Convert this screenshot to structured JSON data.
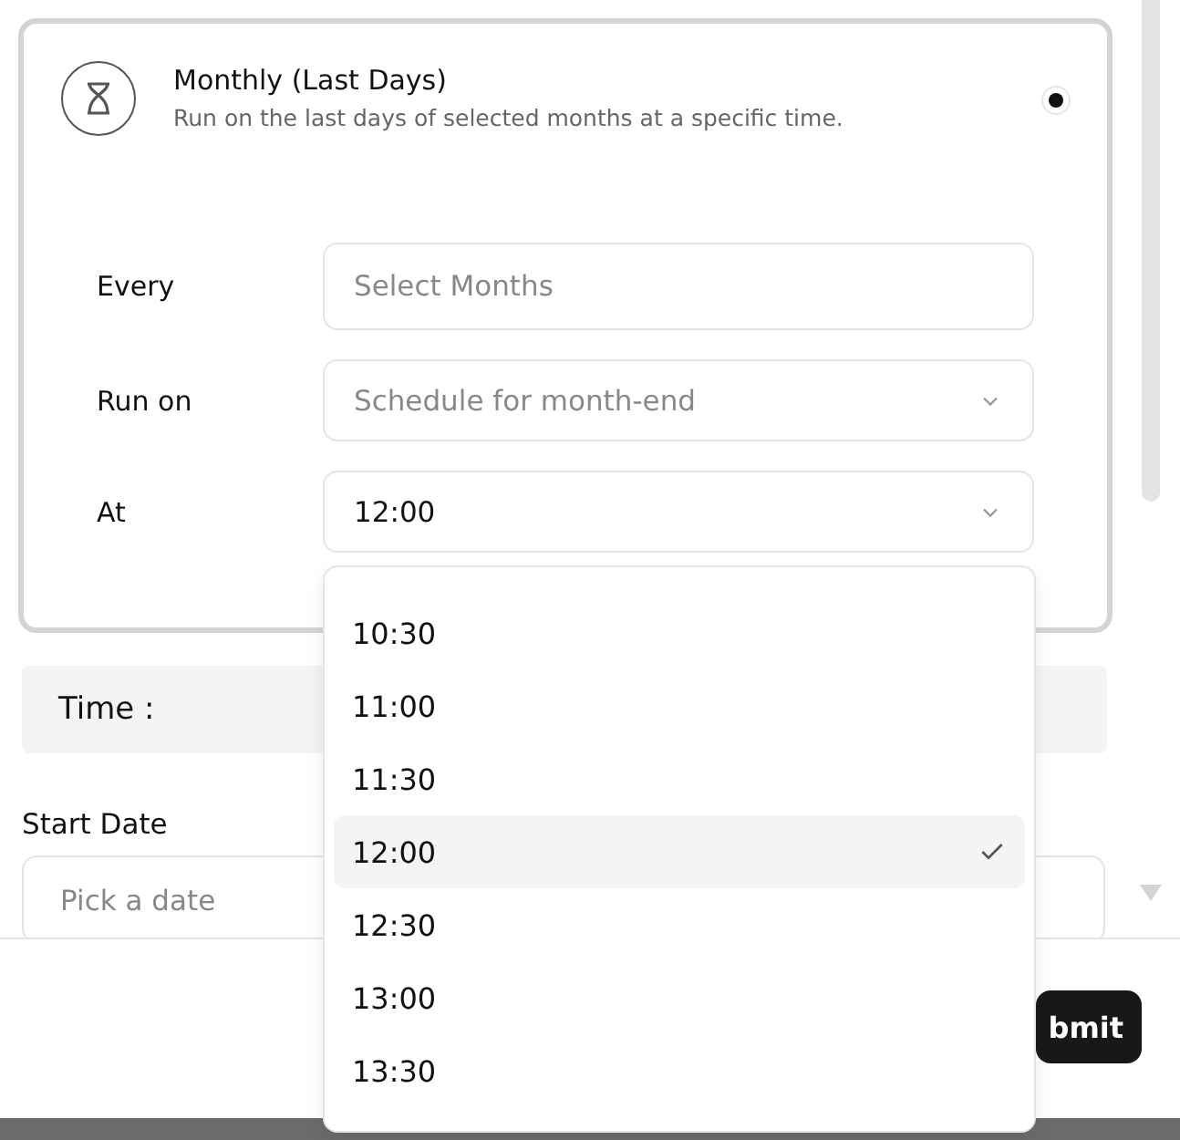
{
  "schedule_card": {
    "title": "Monthly (Last Days)",
    "description": "Run on the last days of selected months at a specific time.",
    "selected": true,
    "fields": [
      {
        "label": "Every",
        "placeholder": "Select Months",
        "kind": "input"
      },
      {
        "label": "Run on",
        "placeholder": "Schedule for month-end",
        "kind": "select"
      },
      {
        "label": "At",
        "value": "12:00",
        "kind": "select"
      }
    ]
  },
  "time_section": {
    "label": "Time :"
  },
  "start_date": {
    "label": "Start Date",
    "placeholder": "Pick a date"
  },
  "submit_button": "bmit",
  "time_dropdown": [
    {
      "label": "10:30",
      "selected": false
    },
    {
      "label": "11:00",
      "selected": false
    },
    {
      "label": "11:30",
      "selected": false
    },
    {
      "label": "12:00",
      "selected": true
    },
    {
      "label": "12:30",
      "selected": false
    },
    {
      "label": "13:00",
      "selected": false
    },
    {
      "label": "13:30",
      "selected": false
    }
  ]
}
